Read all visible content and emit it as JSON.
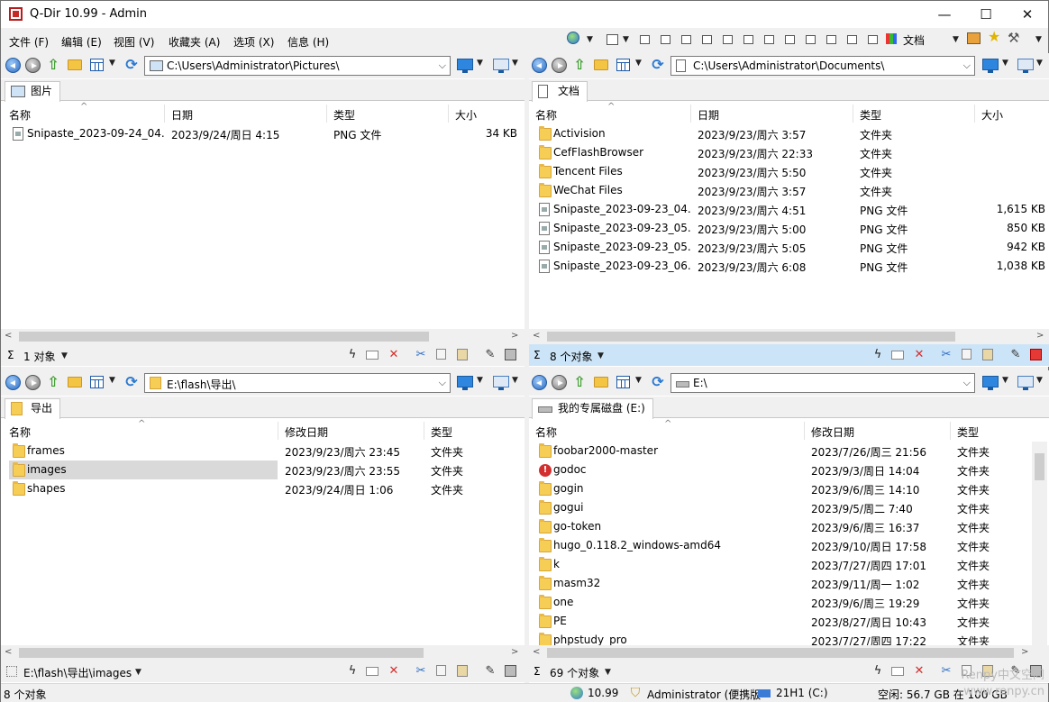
{
  "window": {
    "title": "Q-Dir 10.99 - Admin",
    "minimize": "—",
    "maximize": "☐",
    "close": "✕"
  },
  "menu": [
    "文件 (F)",
    "编辑 (E)",
    "视图 (V)",
    "收藏夹 (A)",
    "选项 (X)",
    "信息 (H)"
  ],
  "menu_right": {
    "doc_label": "文档",
    "icons": [
      "globe-icon",
      "layout-icon",
      "pane-layout-1-icon",
      "pane-layout-2-icon",
      "pane-layout-3-icon",
      "pane-layout-4-icon",
      "pane-layout-5-icon",
      "pane-layout-6-icon",
      "pane-layout-7-icon",
      "pane-layout-8-icon",
      "pane-layout-9-icon",
      "pane-layout-10-icon",
      "pane-layout-11-icon",
      "color-filter-icon",
      "printer-icon",
      "favorites-star-icon",
      "tools-icon"
    ]
  },
  "panes": {
    "tl": {
      "address": "C:\\Users\\Administrator\\Pictures\\",
      "tab": "图片",
      "columns": [
        "名称",
        "日期",
        "类型",
        "大小"
      ],
      "rows": [
        {
          "icon": "file",
          "name": "Snipaste_2023-09-24_04...",
          "date": "2023/9/24/周日 4:15",
          "type": "PNG 文件",
          "size": "34 KB"
        }
      ],
      "status": "1 对象"
    },
    "tr": {
      "address": "C:\\Users\\Administrator\\Documents\\",
      "tab": "文档",
      "columns": [
        "名称",
        "日期",
        "类型",
        "大小"
      ],
      "rows": [
        {
          "icon": "folder",
          "name": "Activision",
          "date": "2023/9/23/周六 3:57",
          "type": "文件夹",
          "size": ""
        },
        {
          "icon": "folder",
          "name": "CefFlashBrowser",
          "date": "2023/9/23/周六 22:33",
          "type": "文件夹",
          "size": ""
        },
        {
          "icon": "folder",
          "name": "Tencent Files",
          "date": "2023/9/23/周六 5:50",
          "type": "文件夹",
          "size": ""
        },
        {
          "icon": "folder",
          "name": "WeChat Files",
          "date": "2023/9/23/周六 3:57",
          "type": "文件夹",
          "size": ""
        },
        {
          "icon": "file",
          "name": "Snipaste_2023-09-23_04...",
          "date": "2023/9/23/周六 4:51",
          "type": "PNG 文件",
          "size": "1,615 KB"
        },
        {
          "icon": "file",
          "name": "Snipaste_2023-09-23_05...",
          "date": "2023/9/23/周六 5:00",
          "type": "PNG 文件",
          "size": "850 KB"
        },
        {
          "icon": "file",
          "name": "Snipaste_2023-09-23_05...",
          "date": "2023/9/23/周六 5:05",
          "type": "PNG 文件",
          "size": "942 KB"
        },
        {
          "icon": "file",
          "name": "Snipaste_2023-09-23_06...",
          "date": "2023/9/23/周六 6:08",
          "type": "PNG 文件",
          "size": "1,038 KB"
        }
      ],
      "status": "8 个对象"
    },
    "bl": {
      "address": "E:\\flash\\导出\\",
      "tab": "导出",
      "columns": [
        "名称",
        "修改日期",
        "类型"
      ],
      "rows": [
        {
          "icon": "folder",
          "name": "frames",
          "date": "2023/9/23/周六 23:45",
          "type": "文件夹"
        },
        {
          "icon": "folder",
          "name": "images",
          "date": "2023/9/23/周六 23:55",
          "type": "文件夹",
          "selected": true
        },
        {
          "icon": "folder",
          "name": "shapes",
          "date": "2023/9/24/周日 1:06",
          "type": "文件夹"
        }
      ],
      "status": "E:\\flash\\导出\\images"
    },
    "br": {
      "address": "E:\\",
      "tab": "我的专属磁盘 (E:)",
      "columns": [
        "名称",
        "修改日期",
        "类型"
      ],
      "rows": [
        {
          "icon": "folder",
          "name": "foobar2000-master",
          "date": "2023/7/26/周三 21:56",
          "type": "文件夹"
        },
        {
          "icon": "warn",
          "name": "godoc",
          "date": "2023/9/3/周日 14:04",
          "type": "文件夹"
        },
        {
          "icon": "folder",
          "name": "gogin",
          "date": "2023/9/6/周三 14:10",
          "type": "文件夹"
        },
        {
          "icon": "folder",
          "name": "gogui",
          "date": "2023/9/5/周二 7:40",
          "type": "文件夹"
        },
        {
          "icon": "folder",
          "name": "go-token",
          "date": "2023/9/6/周三 16:37",
          "type": "文件夹"
        },
        {
          "icon": "folder",
          "name": "hugo_0.118.2_windows-amd64",
          "date": "2023/9/10/周日 17:58",
          "type": "文件夹"
        },
        {
          "icon": "folder",
          "name": "k",
          "date": "2023/7/27/周四 17:01",
          "type": "文件夹"
        },
        {
          "icon": "folder",
          "name": "masm32",
          "date": "2023/9/11/周一 1:02",
          "type": "文件夹"
        },
        {
          "icon": "folder",
          "name": "one",
          "date": "2023/9/6/周三 19:29",
          "type": "文件夹"
        },
        {
          "icon": "folder",
          "name": "PE",
          "date": "2023/8/27/周日 10:43",
          "type": "文件夹"
        },
        {
          "icon": "folder",
          "name": "phpstudy_pro",
          "date": "2023/7/27/周四 17:22",
          "type": "文件夹"
        }
      ],
      "status": "69 个对象"
    }
  },
  "statusbar": {
    "left": "8 个对象",
    "version": "10.99",
    "user": "Administrator (便携版",
    "drive": "21H1 (C:)",
    "free": "空闲: 56.7 GB 在 100 GB"
  },
  "watermark": {
    "line1": "Renpy中文空间",
    "line2": "www.renpy.cn"
  },
  "colors": {
    "active_status": "#cce4f7",
    "selection": "#d9d9d9",
    "close_red": "#d32f2f"
  }
}
